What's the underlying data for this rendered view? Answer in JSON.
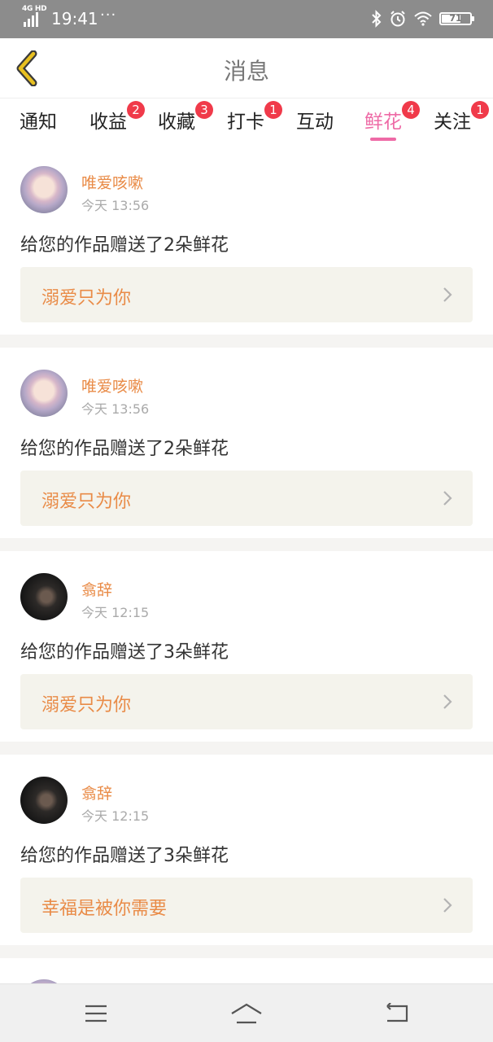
{
  "status_bar": {
    "network": "4G HD",
    "time": "19:41",
    "dots": "···",
    "battery": "71"
  },
  "header": {
    "title": "消息",
    "back_icon": "chevron-left-icon"
  },
  "tabs": [
    {
      "label": "通知",
      "badge": ""
    },
    {
      "label": "收益",
      "badge": "2"
    },
    {
      "label": "收藏",
      "badge": "3"
    },
    {
      "label": "打卡",
      "badge": "1"
    },
    {
      "label": "互动",
      "badge": ""
    },
    {
      "label": "鲜花",
      "badge": "4",
      "active": true
    },
    {
      "label": "关注",
      "badge": "1"
    }
  ],
  "messages": [
    {
      "user": "唯爱咳嗽",
      "time": "今天 13:56",
      "text": "给您的作品赠送了2朵鲜花",
      "work": "溺爱只为你"
    },
    {
      "user": "唯爱咳嗽",
      "time": "今天 13:56",
      "text": "给您的作品赠送了2朵鲜花",
      "work": "溺爱只为你"
    },
    {
      "user": "翕辞",
      "time": "今天 12:15",
      "text": "给您的作品赠送了3朵鲜花",
      "work": "溺爱只为你"
    },
    {
      "user": "翕辞",
      "time": "今天 12:15",
      "text": "给您的作品赠送了3朵鲜花",
      "work": "幸福是被你需要"
    }
  ],
  "colors": {
    "accent_pink": "#ee6aa6",
    "username_orange": "#e98b47",
    "badge_red": "#f03a4a",
    "back_icon_yellow": "#e8c020"
  },
  "navbar": {
    "icons": [
      "menu-icon",
      "home-icon",
      "back-icon"
    ]
  }
}
